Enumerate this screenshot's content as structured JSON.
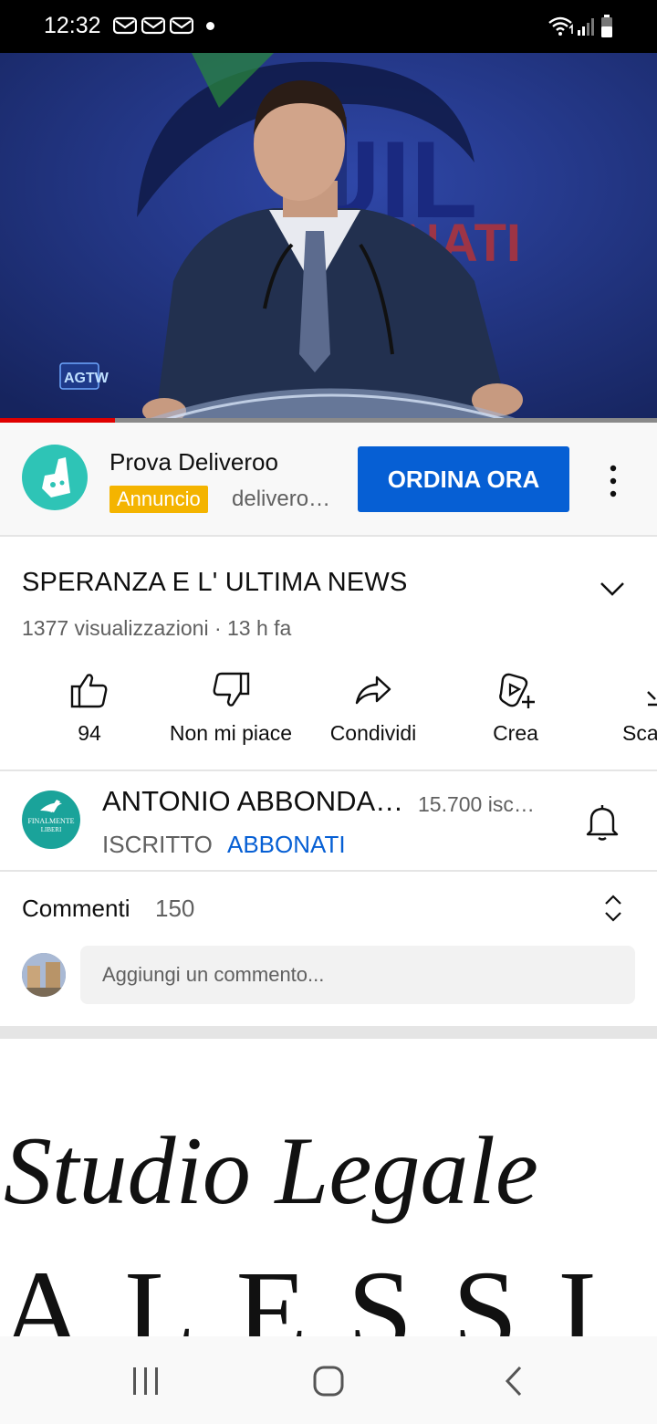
{
  "status_bar": {
    "time": "12:32",
    "notification_icons": [
      "mail-icon",
      "mail-icon",
      "mail-icon"
    ],
    "system_icons": [
      "wifi-icon",
      "signal-icon",
      "battery-icon"
    ]
  },
  "player": {
    "watermark": "AGTW",
    "backdrop_text": "UIL NATI",
    "progress_fraction": 0.175,
    "progress_color": "#e00000"
  },
  "ad": {
    "title": "Prova Deliveroo",
    "badge": "Annuncio",
    "domain": "delivero…",
    "cta": "ORDINA ORA",
    "brand_color": "#2ec4b6",
    "cta_color": "#065fd4"
  },
  "video": {
    "title": "SPERANZA E L' ULTIMA NEWS",
    "meta": "1377 visualizzazioni · 13 h fa"
  },
  "actions": [
    {
      "label": "94",
      "icon": "thumbs-up-icon"
    },
    {
      "label": "Non mi piace",
      "icon": "thumbs-down-icon"
    },
    {
      "label": "Condividi",
      "icon": "share-icon"
    },
    {
      "label": "Crea",
      "icon": "create-icon"
    },
    {
      "label": "Sca",
      "icon": "download-icon"
    }
  ],
  "channel": {
    "name": "ANTONIO ABBONDA…",
    "subscribers": "15.700 isc…",
    "subscribed_label": "ISCRITTO",
    "join_label": "ABBONATI",
    "avatar_text": [
      "FINALMENTE",
      "LIBERI"
    ]
  },
  "comments": {
    "label": "Commenti",
    "count": "150",
    "placeholder": "Aggiungi un commento..."
  },
  "next_thumbnail": {
    "line1": "Studio Legale",
    "line2": "ALESSI"
  },
  "nav_bar": {
    "icons": [
      "recent-apps-icon",
      "home-icon",
      "back-icon"
    ]
  }
}
